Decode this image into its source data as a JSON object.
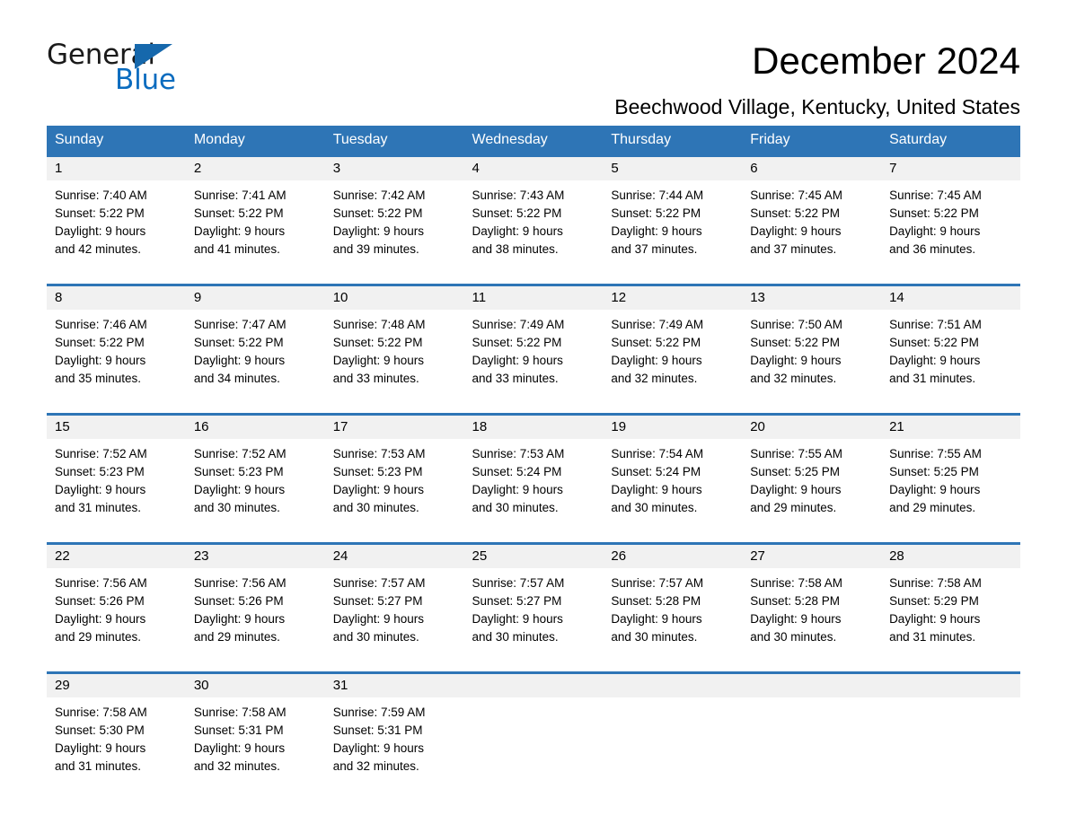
{
  "logo": {
    "word_one": "General",
    "word_two": "Blue",
    "triangle_color": "#1668ac",
    "blue_text_color": "#0b6cbf"
  },
  "header": {
    "title": "December 2024",
    "location": "Beechwood Village, Kentucky, United States"
  },
  "theme": {
    "header_blue": "#2e75b6",
    "daynum_band": "#f1f1f1",
    "text": "#000000"
  },
  "calendar": {
    "weekday_headers": [
      "Sunday",
      "Monday",
      "Tuesday",
      "Wednesday",
      "Thursday",
      "Friday",
      "Saturday"
    ],
    "weeks": [
      [
        {
          "day": "1",
          "sunrise": "Sunrise: 7:40 AM",
          "sunset": "Sunset: 5:22 PM",
          "daylight_1": "Daylight: 9 hours",
          "daylight_2": "and 42 minutes."
        },
        {
          "day": "2",
          "sunrise": "Sunrise: 7:41 AM",
          "sunset": "Sunset: 5:22 PM",
          "daylight_1": "Daylight: 9 hours",
          "daylight_2": "and 41 minutes."
        },
        {
          "day": "3",
          "sunrise": "Sunrise: 7:42 AM",
          "sunset": "Sunset: 5:22 PM",
          "daylight_1": "Daylight: 9 hours",
          "daylight_2": "and 39 minutes."
        },
        {
          "day": "4",
          "sunrise": "Sunrise: 7:43 AM",
          "sunset": "Sunset: 5:22 PM",
          "daylight_1": "Daylight: 9 hours",
          "daylight_2": "and 38 minutes."
        },
        {
          "day": "5",
          "sunrise": "Sunrise: 7:44 AM",
          "sunset": "Sunset: 5:22 PM",
          "daylight_1": "Daylight: 9 hours",
          "daylight_2": "and 37 minutes."
        },
        {
          "day": "6",
          "sunrise": "Sunrise: 7:45 AM",
          "sunset": "Sunset: 5:22 PM",
          "daylight_1": "Daylight: 9 hours",
          "daylight_2": "and 37 minutes."
        },
        {
          "day": "7",
          "sunrise": "Sunrise: 7:45 AM",
          "sunset": "Sunset: 5:22 PM",
          "daylight_1": "Daylight: 9 hours",
          "daylight_2": "and 36 minutes."
        }
      ],
      [
        {
          "day": "8",
          "sunrise": "Sunrise: 7:46 AM",
          "sunset": "Sunset: 5:22 PM",
          "daylight_1": "Daylight: 9 hours",
          "daylight_2": "and 35 minutes."
        },
        {
          "day": "9",
          "sunrise": "Sunrise: 7:47 AM",
          "sunset": "Sunset: 5:22 PM",
          "daylight_1": "Daylight: 9 hours",
          "daylight_2": "and 34 minutes."
        },
        {
          "day": "10",
          "sunrise": "Sunrise: 7:48 AM",
          "sunset": "Sunset: 5:22 PM",
          "daylight_1": "Daylight: 9 hours",
          "daylight_2": "and 33 minutes."
        },
        {
          "day": "11",
          "sunrise": "Sunrise: 7:49 AM",
          "sunset": "Sunset: 5:22 PM",
          "daylight_1": "Daylight: 9 hours",
          "daylight_2": "and 33 minutes."
        },
        {
          "day": "12",
          "sunrise": "Sunrise: 7:49 AM",
          "sunset": "Sunset: 5:22 PM",
          "daylight_1": "Daylight: 9 hours",
          "daylight_2": "and 32 minutes."
        },
        {
          "day": "13",
          "sunrise": "Sunrise: 7:50 AM",
          "sunset": "Sunset: 5:22 PM",
          "daylight_1": "Daylight: 9 hours",
          "daylight_2": "and 32 minutes."
        },
        {
          "day": "14",
          "sunrise": "Sunrise: 7:51 AM",
          "sunset": "Sunset: 5:22 PM",
          "daylight_1": "Daylight: 9 hours",
          "daylight_2": "and 31 minutes."
        }
      ],
      [
        {
          "day": "15",
          "sunrise": "Sunrise: 7:52 AM",
          "sunset": "Sunset: 5:23 PM",
          "daylight_1": "Daylight: 9 hours",
          "daylight_2": "and 31 minutes."
        },
        {
          "day": "16",
          "sunrise": "Sunrise: 7:52 AM",
          "sunset": "Sunset: 5:23 PM",
          "daylight_1": "Daylight: 9 hours",
          "daylight_2": "and 30 minutes."
        },
        {
          "day": "17",
          "sunrise": "Sunrise: 7:53 AM",
          "sunset": "Sunset: 5:23 PM",
          "daylight_1": "Daylight: 9 hours",
          "daylight_2": "and 30 minutes."
        },
        {
          "day": "18",
          "sunrise": "Sunrise: 7:53 AM",
          "sunset": "Sunset: 5:24 PM",
          "daylight_1": "Daylight: 9 hours",
          "daylight_2": "and 30 minutes."
        },
        {
          "day": "19",
          "sunrise": "Sunrise: 7:54 AM",
          "sunset": "Sunset: 5:24 PM",
          "daylight_1": "Daylight: 9 hours",
          "daylight_2": "and 30 minutes."
        },
        {
          "day": "20",
          "sunrise": "Sunrise: 7:55 AM",
          "sunset": "Sunset: 5:25 PM",
          "daylight_1": "Daylight: 9 hours",
          "daylight_2": "and 29 minutes."
        },
        {
          "day": "21",
          "sunrise": "Sunrise: 7:55 AM",
          "sunset": "Sunset: 5:25 PM",
          "daylight_1": "Daylight: 9 hours",
          "daylight_2": "and 29 minutes."
        }
      ],
      [
        {
          "day": "22",
          "sunrise": "Sunrise: 7:56 AM",
          "sunset": "Sunset: 5:26 PM",
          "daylight_1": "Daylight: 9 hours",
          "daylight_2": "and 29 minutes."
        },
        {
          "day": "23",
          "sunrise": "Sunrise: 7:56 AM",
          "sunset": "Sunset: 5:26 PM",
          "daylight_1": "Daylight: 9 hours",
          "daylight_2": "and 29 minutes."
        },
        {
          "day": "24",
          "sunrise": "Sunrise: 7:57 AM",
          "sunset": "Sunset: 5:27 PM",
          "daylight_1": "Daylight: 9 hours",
          "daylight_2": "and 30 minutes."
        },
        {
          "day": "25",
          "sunrise": "Sunrise: 7:57 AM",
          "sunset": "Sunset: 5:27 PM",
          "daylight_1": "Daylight: 9 hours",
          "daylight_2": "and 30 minutes."
        },
        {
          "day": "26",
          "sunrise": "Sunrise: 7:57 AM",
          "sunset": "Sunset: 5:28 PM",
          "daylight_1": "Daylight: 9 hours",
          "daylight_2": "and 30 minutes."
        },
        {
          "day": "27",
          "sunrise": "Sunrise: 7:58 AM",
          "sunset": "Sunset: 5:28 PM",
          "daylight_1": "Daylight: 9 hours",
          "daylight_2": "and 30 minutes."
        },
        {
          "day": "28",
          "sunrise": "Sunrise: 7:58 AM",
          "sunset": "Sunset: 5:29 PM",
          "daylight_1": "Daylight: 9 hours",
          "daylight_2": "and 31 minutes."
        }
      ],
      [
        {
          "day": "29",
          "sunrise": "Sunrise: 7:58 AM",
          "sunset": "Sunset: 5:30 PM",
          "daylight_1": "Daylight: 9 hours",
          "daylight_2": "and 31 minutes."
        },
        {
          "day": "30",
          "sunrise": "Sunrise: 7:58 AM",
          "sunset": "Sunset: 5:31 PM",
          "daylight_1": "Daylight: 9 hours",
          "daylight_2": "and 32 minutes."
        },
        {
          "day": "31",
          "sunrise": "Sunrise: 7:59 AM",
          "sunset": "Sunset: 5:31 PM",
          "daylight_1": "Daylight: 9 hours",
          "daylight_2": "and 32 minutes."
        },
        {
          "day": "",
          "sunrise": "",
          "sunset": "",
          "daylight_1": "",
          "daylight_2": ""
        },
        {
          "day": "",
          "sunrise": "",
          "sunset": "",
          "daylight_1": "",
          "daylight_2": ""
        },
        {
          "day": "",
          "sunrise": "",
          "sunset": "",
          "daylight_1": "",
          "daylight_2": ""
        },
        {
          "day": "",
          "sunrise": "",
          "sunset": "",
          "daylight_1": "",
          "daylight_2": ""
        }
      ]
    ]
  }
}
